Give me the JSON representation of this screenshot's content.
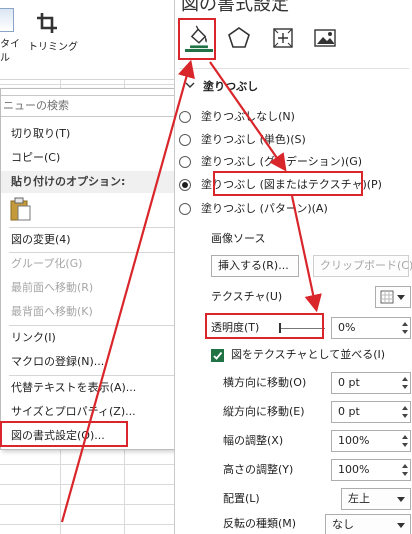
{
  "ribbon": {
    "style_label": "タイ\nル",
    "trim_label": "トリミング",
    "trim_icon": "crop-icon"
  },
  "context_menu": {
    "search_placeholder": "ニューの検索",
    "items": [
      {
        "label": "切り取り(T)",
        "enabled": true,
        "submenu": false
      },
      {
        "label": "コピー(C)",
        "enabled": true,
        "submenu": false
      },
      {
        "label": "貼り付けのオプション:",
        "enabled": true,
        "submenu": false,
        "header": true
      },
      {
        "label": "図の変更(4)",
        "enabled": true,
        "submenu": true
      },
      {
        "label": "グループ化(G)",
        "enabled": false,
        "submenu": true
      },
      {
        "label": "最前面へ移動(R)",
        "enabled": false,
        "submenu": true
      },
      {
        "label": "最背面へ移動(K)",
        "enabled": false,
        "submenu": true
      },
      {
        "label": "リンク(I)",
        "enabled": true,
        "submenu": false
      },
      {
        "label": "マクロの登録(N)...",
        "enabled": true,
        "submenu": false
      },
      {
        "label": "代替テキストを表示(A)...",
        "enabled": true,
        "submenu": false
      },
      {
        "label": "サイズとプロパティ(Z)...",
        "enabled": true,
        "submenu": false
      },
      {
        "label": "図の書式設定(O)...",
        "enabled": true,
        "submenu": false,
        "highlighted": true
      }
    ]
  },
  "format_pane": {
    "title": "図の書式設定",
    "tabs": [
      {
        "icon": "fill-line-icon",
        "active": true
      },
      {
        "icon": "effects-pentagon-icon",
        "active": false
      },
      {
        "icon": "size-properties-icon",
        "active": false
      },
      {
        "icon": "picture-icon",
        "active": false
      }
    ],
    "fill_section": {
      "title": "塗りつぶし",
      "options": [
        {
          "label": "塗りつぶしなし(N)",
          "checked": false
        },
        {
          "label": "塗りつぶし (単色)(S)",
          "checked": false
        },
        {
          "label": "塗りつぶし (グラデーション)(G)",
          "checked": false
        },
        {
          "label": "塗りつぶし (図またはテクスチャ)(P)",
          "checked": true
        },
        {
          "label": "塗りつぶし (パターン)(A)",
          "checked": false
        }
      ],
      "image_source_label": "画像ソース",
      "insert_button": "挿入する(R)...",
      "clipboard_button": "クリップボード(C)",
      "texture_label": "テクスチャ(U)",
      "transparency_label": "透明度(T)",
      "transparency_value": "0%",
      "tile_checkbox_label": "図をテクスチャとして並べる(I)",
      "tile_checked": true,
      "offset_x_label": "横方向に移動(O)",
      "offset_x_value": "0 pt",
      "offset_y_label": "縦方向に移動(E)",
      "offset_y_value": "0 pt",
      "scale_x_label": "幅の調整(X)",
      "scale_x_value": "100%",
      "scale_y_label": "高さの調整(Y)",
      "scale_y_value": "100%",
      "alignment_label": "配置(L)",
      "alignment_value": "左上",
      "mirror_label": "反転の種類(M)",
      "mirror_value": "なし"
    }
  },
  "annotation_color": "#d9262b",
  "accent_color": "#217346"
}
